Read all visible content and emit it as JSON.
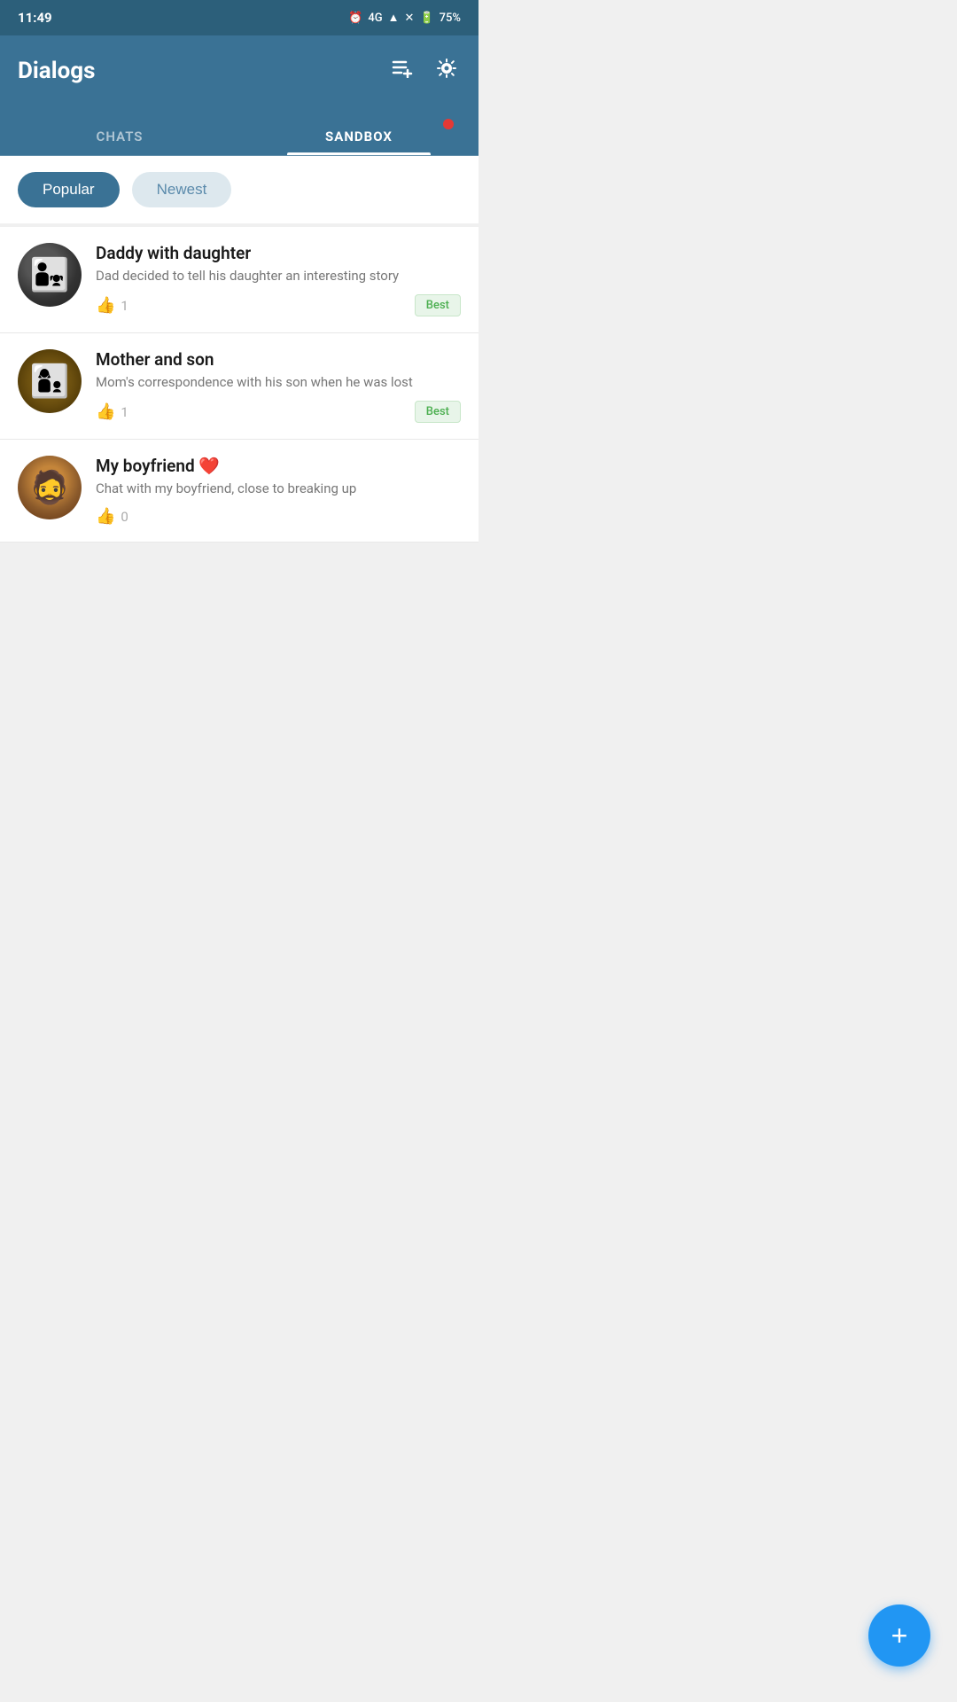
{
  "statusBar": {
    "time": "11:49",
    "network": "4G",
    "battery": "75%"
  },
  "header": {
    "title": "Dialogs",
    "addListIcon": "list-add-icon",
    "settingsIcon": "gear-icon"
  },
  "tabs": [
    {
      "id": "chats",
      "label": "CHATS",
      "active": false
    },
    {
      "id": "sandbox",
      "label": "SANDBOX",
      "active": true,
      "hasBadge": true
    }
  ],
  "filters": [
    {
      "id": "popular",
      "label": "Popular",
      "active": true
    },
    {
      "id": "newest",
      "label": "Newest",
      "active": false
    }
  ],
  "chats": [
    {
      "id": 1,
      "title": "Daddy with daughter",
      "subtitle": "Dad decided to tell his daughter an interesting story",
      "likes": 1,
      "hasBest": true,
      "bestLabel": "Best"
    },
    {
      "id": 2,
      "title": "Mother and son",
      "subtitle": "Mom's correspondence with his son when he was lost",
      "likes": 1,
      "hasBest": true,
      "bestLabel": "Best"
    },
    {
      "id": 3,
      "title": "My boyfriend ❤️",
      "subtitle": "Chat with my boyfriend, close to breaking up",
      "likes": 0,
      "hasBest": false,
      "bestLabel": ""
    }
  ],
  "fab": {
    "label": "+"
  },
  "colors": {
    "headerBg": "#3a7295",
    "tabActive": "#ffffff",
    "tabInactive": "rgba(255,255,255,0.6)",
    "filterActive": "#3a7295",
    "filterInactive": "#dde8ee",
    "badgeColor": "#e53935",
    "bestBadgeBg": "#e8f5e9",
    "bestBadgeText": "#4caf50",
    "fabBg": "#2196f3"
  }
}
